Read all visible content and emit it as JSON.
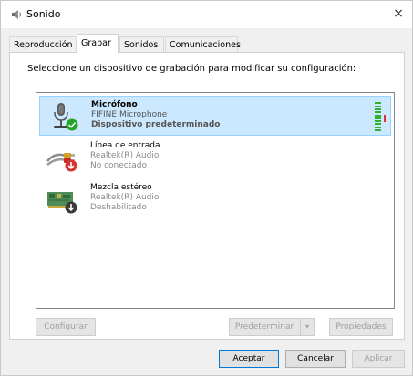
{
  "window": {
    "title": "Sonido",
    "close_glyph": "×"
  },
  "tabs": [
    {
      "label": "Reproducción",
      "active": false
    },
    {
      "label": "Grabar",
      "active": true
    },
    {
      "label": "Sonidos",
      "active": false
    },
    {
      "label": "Comunicaciones",
      "active": false
    }
  ],
  "instructions": "Seleccione un dispositivo de grabación para modificar su configuración:",
  "devices": [
    {
      "name": "Micrófono",
      "subtitle": "FIFINE Microphone",
      "status": "Dispositivo predeterminado",
      "icon": "microphone-icon",
      "badge": "default-check-icon",
      "selected": true,
      "level_bars": 10
    },
    {
      "name": "Línea de entrada",
      "subtitle": "Realtek(R) Audio",
      "status": "No conectado",
      "icon": "line-in-cable-icon",
      "badge": "disconnected-arrow-icon",
      "selected": false
    },
    {
      "name": "Mezcla estéreo",
      "subtitle": "Realtek(R) Audio",
      "status": "Deshabilitado",
      "icon": "sound-card-icon",
      "badge": "disabled-arrow-icon",
      "selected": false
    }
  ],
  "panel_buttons": {
    "configure": "Configurar",
    "set_default": "Predeterminar",
    "properties": "Propiedades"
  },
  "dialog_buttons": {
    "ok": "Aceptar",
    "cancel": "Cancelar",
    "apply": "Aplicar"
  },
  "colors": {
    "selection_bg": "#cce8ff",
    "selection_border": "#99d1ff",
    "level_green": "#2fb12f",
    "default_check_green": "#27a327",
    "badge_red": "#d83434"
  }
}
